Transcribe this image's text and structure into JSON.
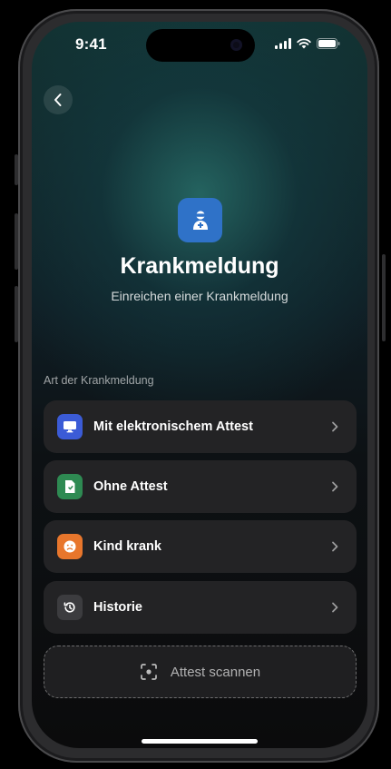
{
  "status_bar": {
    "time": "9:41"
  },
  "header": {
    "title": "Krankmeldung",
    "subtitle": "Einreichen einer Krankmeldung",
    "hero_icon": "sick-person-icon",
    "hero_color": "#2f72c8"
  },
  "section": {
    "label": "Art der Krankmeldung"
  },
  "options": [
    {
      "label": "Mit elektronischem Attest",
      "icon": "monitor-icon",
      "color": "#3b5bd6"
    },
    {
      "label": "Ohne Attest",
      "icon": "document-icon",
      "color": "#2e8a52"
    },
    {
      "label": "Kind krank",
      "icon": "sad-face-icon",
      "color": "#e8762c"
    },
    {
      "label": "Historie",
      "icon": "history-icon",
      "color": "#3c3c3f"
    }
  ],
  "scan_button": {
    "label": "Attest scannen",
    "icon": "scan-icon"
  }
}
